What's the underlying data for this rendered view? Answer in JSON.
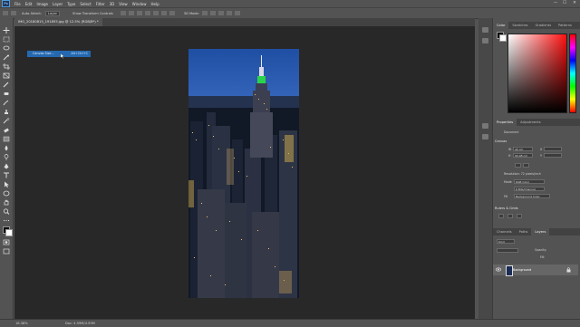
{
  "menubar": {
    "app_icon": "Ps",
    "items": [
      "File",
      "Edit",
      "Image",
      "Layer",
      "Type",
      "Select",
      "Filter",
      "3D",
      "View",
      "Window",
      "Help"
    ],
    "window_controls": [
      "—",
      "☐",
      "✕"
    ]
  },
  "options": {
    "auto_select": "Auto-Select:",
    "auto_select_target": "Layer",
    "show_transform": "Show Transform Controls",
    "mode_3d": "3D Mode:"
  },
  "document": {
    "tab_label": "IMG_20180815_191855.jpg @ 12.5% (RGB/8*) *"
  },
  "popup": {
    "label": "Canvas Size...",
    "shortcut": "Alt+Ctrl+C"
  },
  "status": {
    "zoom": "16.38%",
    "doc": "Doc: 4.59M/4.59M"
  },
  "panels": {
    "color_tabs": [
      "Color",
      "Swatches",
      "Gradients",
      "Patterns"
    ],
    "properties_tabs": [
      "Properties",
      "Adjustments"
    ],
    "document_label": "Document",
    "canvas_section": "Canvas",
    "width_label": "W",
    "width_value": "40 cm",
    "height_label": "H",
    "height_value": "90.98 cm",
    "x_label": "X",
    "y_label": "Y",
    "resolution": "Resolution: 72 pixels/inch",
    "mode_label": "Mode",
    "mode_value": "RGB Color",
    "depth_value": "8 Bits/Channel",
    "fill_label": "Fill",
    "fill_value": "Background Color",
    "rulers_section": "Rulers & Grids",
    "layer_tabs": [
      "Channels",
      "Paths",
      "Layers"
    ],
    "kind_label": "Kind",
    "opacity_label": "Opacity:",
    "fill_lock": "Fill:",
    "layer_name": "Background"
  },
  "colors": {
    "accent": "#2469b0",
    "bg": "#535353",
    "canvas": "#282828"
  }
}
